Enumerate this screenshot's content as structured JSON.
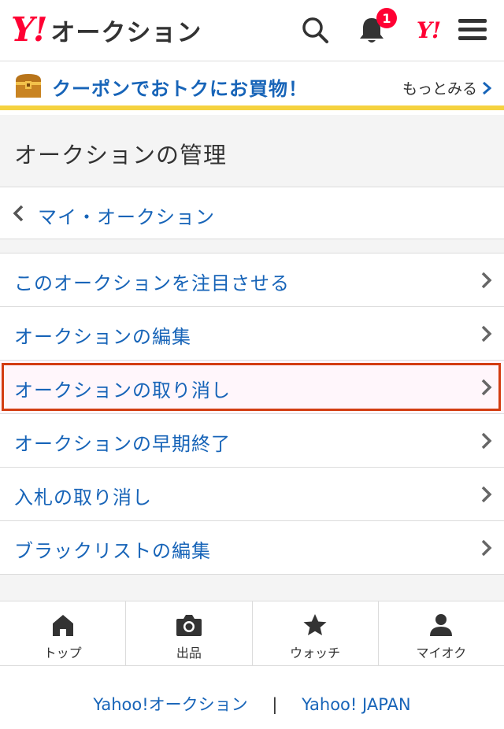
{
  "header": {
    "logo_mark": "Y!",
    "logo_text": "オークション",
    "notification_count": "1",
    "yj_mark": "Y!"
  },
  "coupon": {
    "text": "クーポンでおトクにお買物！",
    "more_label": "もっとみる"
  },
  "section": {
    "title": "オークションの管理"
  },
  "back": {
    "label": "マイ・オークション"
  },
  "menu": {
    "items": [
      {
        "label": "このオークションを注目させる"
      },
      {
        "label": "オークションの編集"
      },
      {
        "label": "オークションの取り消し"
      },
      {
        "label": "オークションの早期終了"
      },
      {
        "label": "入札の取り消し"
      },
      {
        "label": "ブラックリストの編集"
      }
    ]
  },
  "bottom_nav": {
    "items": [
      {
        "label": "トップ",
        "icon": "home-icon"
      },
      {
        "label": "出品",
        "icon": "camera-icon"
      },
      {
        "label": "ウォッチ",
        "icon": "star-icon"
      },
      {
        "label": "マイオク",
        "icon": "user-icon"
      }
    ]
  },
  "footer": {
    "link1": "Yahoo!オークション",
    "separator": "|",
    "link2": "Yahoo! JAPAN"
  },
  "colors": {
    "brand_red": "#ff0033",
    "link_blue": "#1764b8",
    "coupon_border": "#f5d23f",
    "highlight_border": "#d33d12"
  }
}
